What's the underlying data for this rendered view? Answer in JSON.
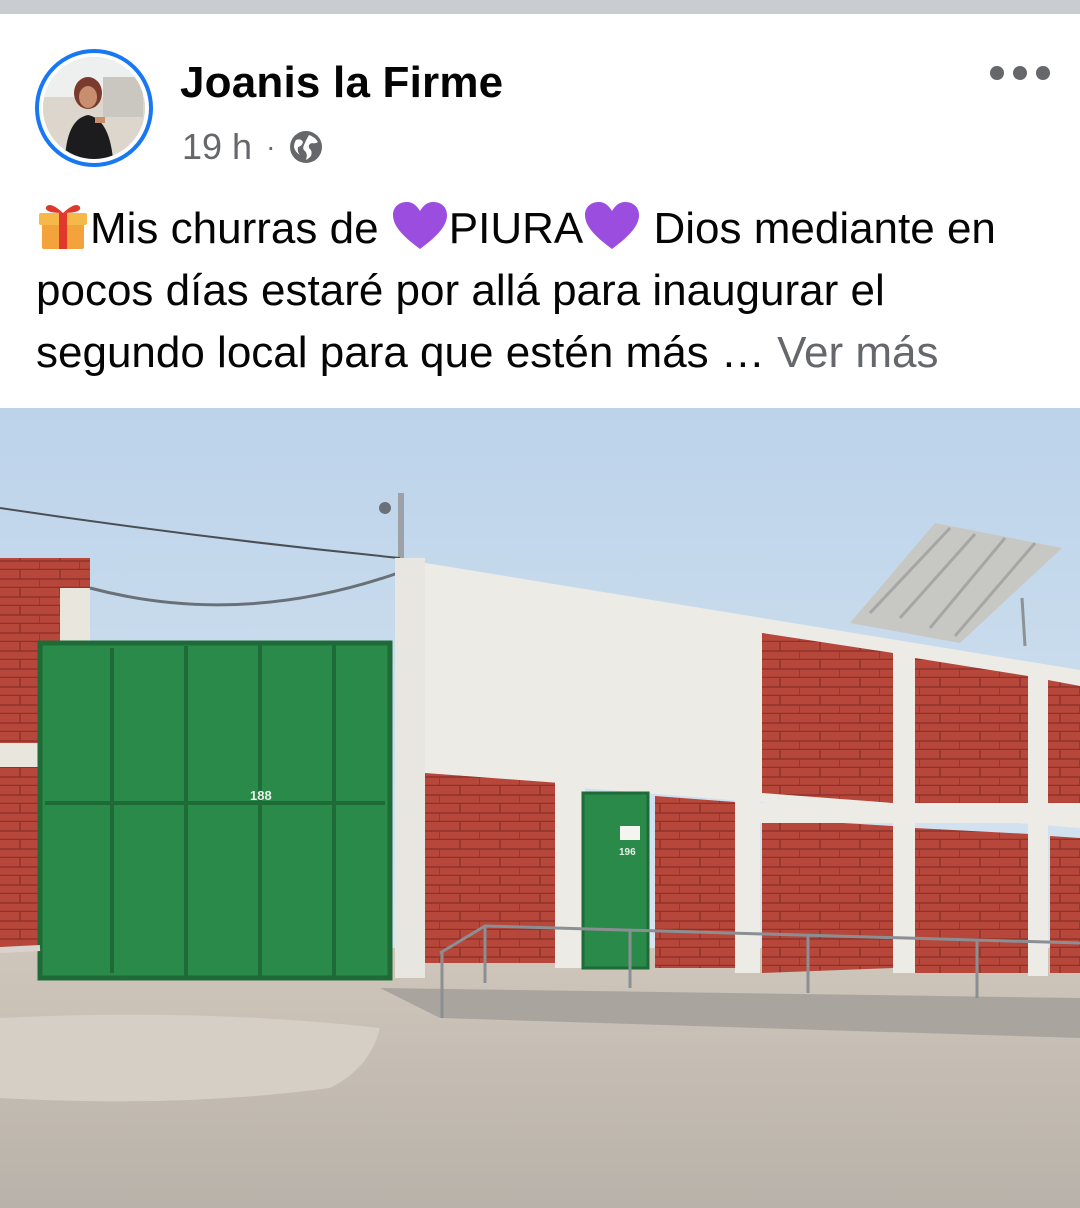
{
  "post": {
    "author": "Joanis la Firme",
    "time": "19 h",
    "separator": "·",
    "privacy_icon": "globe-icon",
    "options_icon": "more-options-icon",
    "text_segments": {
      "part1": "Mis churras de ",
      "part2": "PIURA",
      "part3": " Dios mediante en pocos días estaré por allá para inaugurar el segundo local para que estén más … ",
      "see_more": "Ver más"
    },
    "emojis": [
      "gift-emoji",
      "purple-heart-emoji",
      "purple-heart-emoji"
    ],
    "photo": {
      "gate_number": "188",
      "door_number": "196"
    }
  },
  "colors": {
    "accent": "#1877f2",
    "secondary_text": "#65676b",
    "divider": "#c9ccd1",
    "purple_heart": "#9b4de0"
  }
}
